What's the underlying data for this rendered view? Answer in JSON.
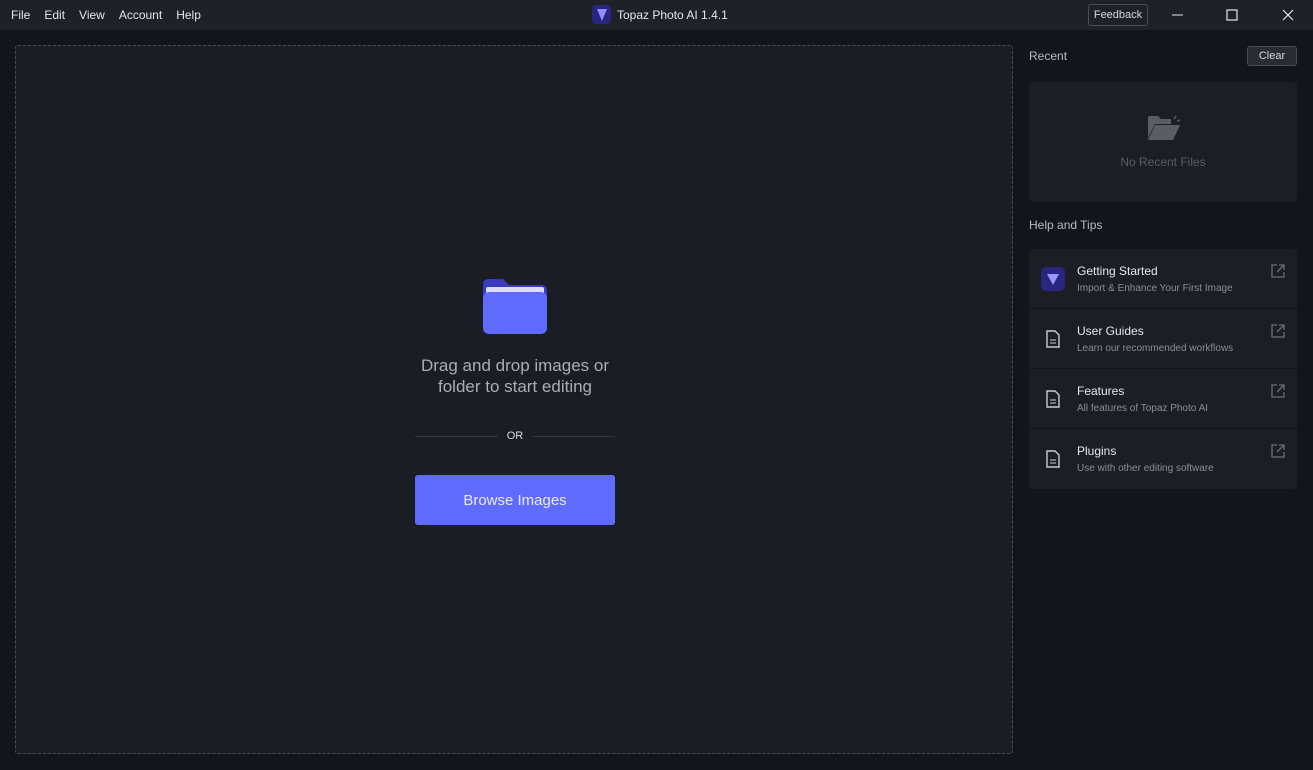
{
  "menu": [
    "File",
    "Edit",
    "View",
    "Account",
    "Help"
  ],
  "app_title": "Topaz Photo AI 1.4.1",
  "feedback": "Feedback",
  "drop": {
    "text_line1": "Drag and drop images or",
    "text_line2": "folder to start editing",
    "or": "OR",
    "browse": "Browse Images"
  },
  "recent": {
    "heading": "Recent",
    "clear": "Clear",
    "empty": "No Recent Files"
  },
  "help": {
    "heading": "Help and Tips",
    "items": [
      {
        "title": "Getting Started",
        "subtitle": "Import & Enhance Your First Image",
        "icon": "topaz-logo-icon"
      },
      {
        "title": "User Guides",
        "subtitle": "Learn our recommended workflows",
        "icon": "document-icon"
      },
      {
        "title": "Features",
        "subtitle": "All features of Topaz Photo AI",
        "icon": "document-icon"
      },
      {
        "title": "Plugins",
        "subtitle": "Use with other editing software",
        "icon": "document-icon"
      }
    ]
  },
  "colors": {
    "accent": "#5f6bfe",
    "background": "#13151a",
    "panel": "#1c1e25"
  }
}
